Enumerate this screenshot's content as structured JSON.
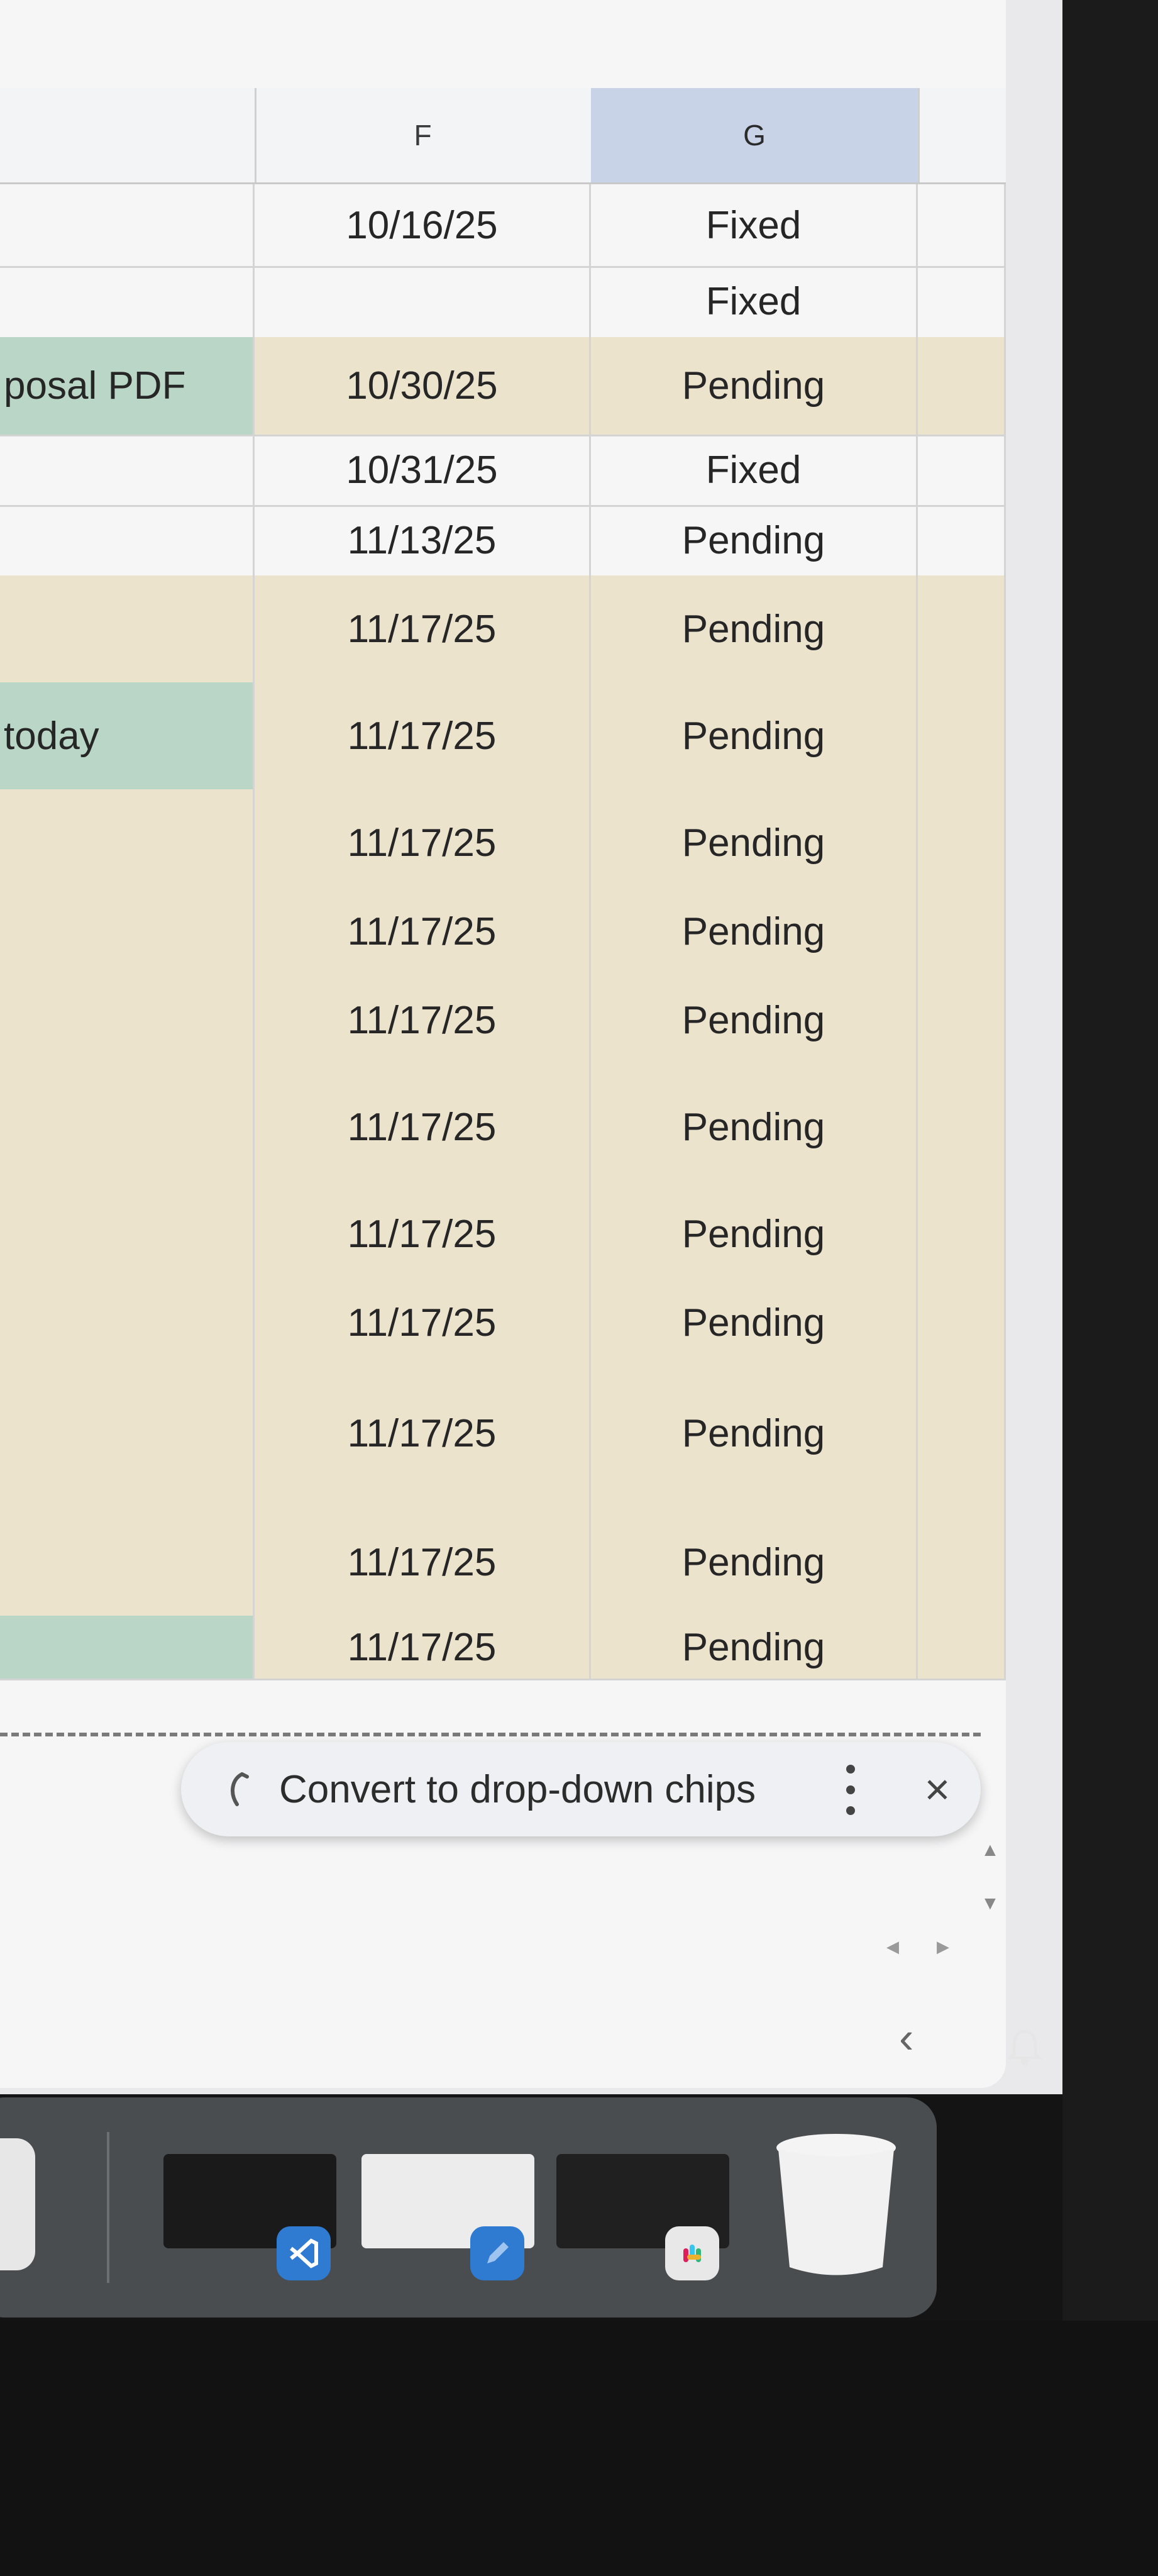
{
  "columns": [
    {
      "label": "",
      "selected": false
    },
    {
      "label": "F",
      "selected": false
    },
    {
      "label": "G",
      "selected": true
    },
    {
      "label": "",
      "selected": false
    }
  ],
  "rows": [
    {
      "col_e": "",
      "col_f": "10/16/25",
      "col_g": "Fixed",
      "fill": "none"
    },
    {
      "col_e": "",
      "col_f": "",
      "col_g": "Fixed",
      "fill": "none"
    },
    {
      "col_e": "posal PDF",
      "col_f": "10/30/25",
      "col_g": "Pending",
      "fill": "green-e"
    },
    {
      "col_e": "",
      "col_f": "10/31/25",
      "col_g": "Fixed",
      "fill": "none"
    },
    {
      "col_e": "",
      "col_f": "11/13/25",
      "col_g": "Pending",
      "fill": "none"
    },
    {
      "col_e": "",
      "col_f": "11/17/25",
      "col_g": "Pending",
      "fill": "tan"
    },
    {
      "col_e": "today",
      "col_f": "11/17/25",
      "col_g": "Pending",
      "fill": "green-e"
    },
    {
      "col_e": "",
      "col_f": "11/17/25",
      "col_g": "Pending",
      "fill": "tan"
    },
    {
      "col_e": "",
      "col_f": "11/17/25",
      "col_g": "Pending",
      "fill": "tan"
    },
    {
      "col_e": "",
      "col_f": "11/17/25",
      "col_g": "Pending",
      "fill": "tan"
    },
    {
      "col_e": "",
      "col_f": "11/17/25",
      "col_g": "Pending",
      "fill": "tan"
    },
    {
      "col_e": "",
      "col_f": "11/17/25",
      "col_g": "Pending",
      "fill": "tan"
    },
    {
      "col_e": "",
      "col_f": "11/17/25",
      "col_g": "Pending",
      "fill": "tan"
    },
    {
      "col_e": "",
      "col_f": "11/17/25",
      "col_g": "Pending",
      "fill": "tan"
    },
    {
      "col_e": "",
      "col_f": "11/17/25",
      "col_g": "Pending",
      "fill": "tan"
    },
    {
      "col_e": "",
      "col_f": "11/17/25",
      "col_g": "Pending",
      "fill": "green-e"
    }
  ],
  "toast": {
    "message": "Convert to drop-down chips",
    "icon": "chips-sparkle-icon"
  },
  "dock": {
    "apps": [
      {
        "name": "vscode",
        "badge_icon": "vscode-icon",
        "badge_color": "#2f7bd2"
      },
      {
        "name": "preview",
        "badge_icon": "pencil-icon",
        "badge_color": "#2f7bd2"
      },
      {
        "name": "slack",
        "badge_icon": "slack-icon",
        "badge_color": "#e8e8e8"
      }
    ],
    "trash_icon": "trash-icon"
  },
  "colors": {
    "tan_fill": "#ece3cd",
    "green_fill": "#b9d6c6",
    "selected_header": "#c8d3e8"
  }
}
